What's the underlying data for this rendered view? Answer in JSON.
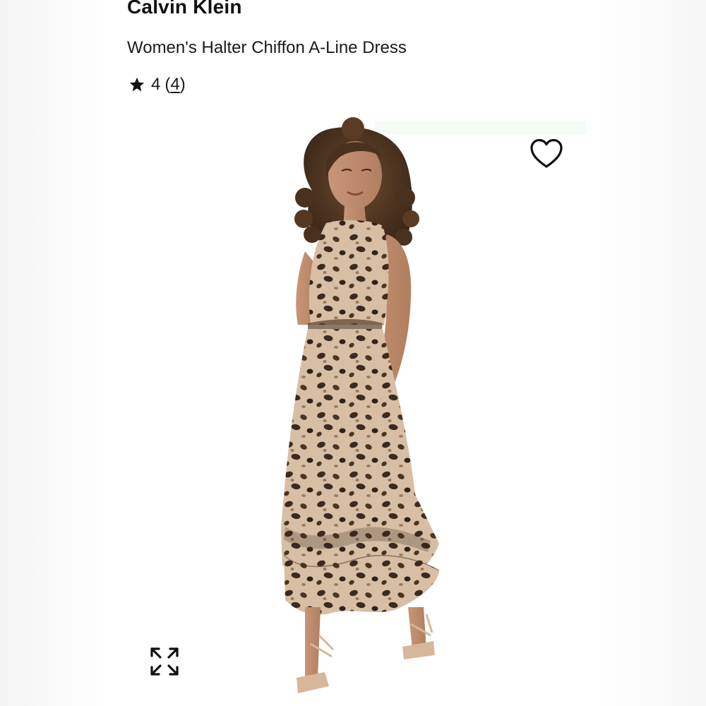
{
  "product": {
    "brand": "Calvin Klein",
    "title": "Women's Halter Chiffon A-Line Dress",
    "rating_value": "4",
    "review_count": "4"
  },
  "icons": {
    "rating": "star-icon",
    "favorite": "heart-icon",
    "image_zoom": "expand-icon"
  },
  "colors": {
    "text": "#111111",
    "print_light": "#d9c0a6",
    "print_spot": "#3a2a1f"
  }
}
